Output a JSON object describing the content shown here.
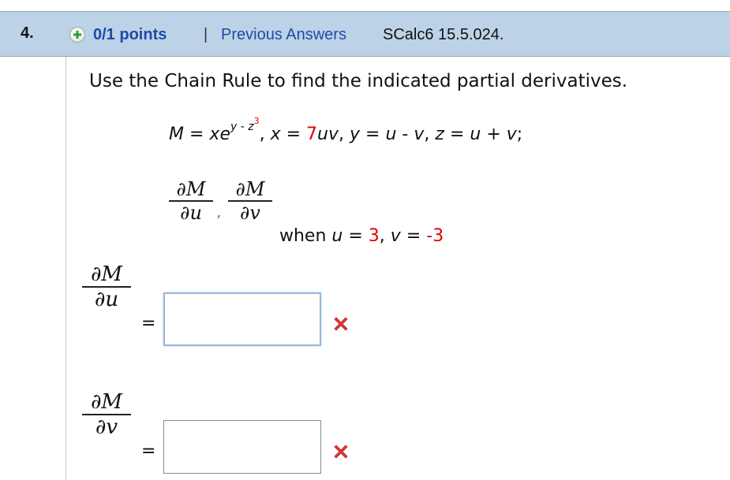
{
  "header": {
    "question_number": "4.",
    "points_text": "0/1 points",
    "separator": "|",
    "previous_answers_link": "Previous Answers",
    "reference": "SCalc6 15.5.024."
  },
  "question": {
    "instruction": "Use the Chain Rule to find the indicated partial derivatives.",
    "function": {
      "lhs": "M",
      "eq": " = ",
      "x_var": "x",
      "e_char": "e",
      "exp_y": "y",
      "exp_mid": " - ",
      "exp_z": "z",
      "exp_pow": "3",
      "sep1": ", ",
      "x2": "x",
      "eq2": " = ",
      "x_coef": "7",
      "uv": "uv",
      "sep2": ", ",
      "y2": "y",
      "eq3": " = ",
      "y_u": "u",
      "y_minus": " - ",
      "y_v": "v",
      "sep3": ", ",
      "z2": "z",
      "eq4": " = ",
      "z_u": "u",
      "z_plus": " + ",
      "z_v": "v",
      "end": ";"
    },
    "derivs": {
      "num": "∂M",
      "den_u": "∂u",
      "den_v": "∂v",
      "comma": ","
    },
    "condition": {
      "when": "when ",
      "u": "u",
      "eq1": " = ",
      "u_val": "3",
      "sep": ", ",
      "v": "v",
      "eq2": " = ",
      "v_val": "-3"
    }
  },
  "answers": [
    {
      "num": "∂M",
      "den": "∂u",
      "eq": "=",
      "value": "",
      "status_icon": "incorrect-x-icon"
    },
    {
      "num": "∂M",
      "den": "∂v",
      "eq": "=",
      "value": "",
      "status_icon": "incorrect-x-icon"
    }
  ],
  "colors": {
    "header_bg": "#bcd3e7",
    "link": "#1f49a6",
    "highlight_red": "#e00000",
    "incorrect_icon": "#e03a3a",
    "plus_icon": "#2e9a2e"
  }
}
